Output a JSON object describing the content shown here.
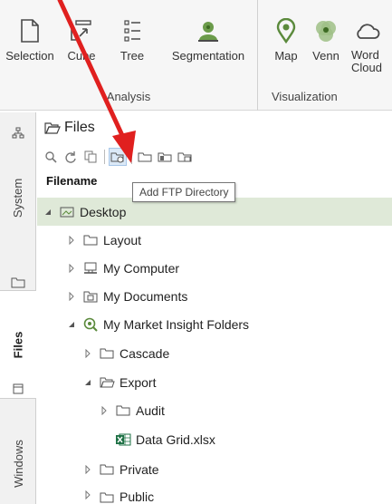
{
  "ribbon": {
    "analysis": {
      "label": "Analysis",
      "buttons": [
        {
          "label": "Selection",
          "icon": "selection-icon"
        },
        {
          "label": "Cube",
          "icon": "cube-icon"
        },
        {
          "label": "Tree",
          "icon": "tree-icon"
        },
        {
          "label": "Segmentation",
          "icon": "segmentation-icon"
        }
      ]
    },
    "visualization": {
      "label": "Visualization",
      "buttons": [
        {
          "label": "Map",
          "icon": "map-pin-icon"
        },
        {
          "label": "Venn",
          "icon": "venn-icon"
        },
        {
          "label": "Word\nCloud",
          "icon": "cloud-icon"
        }
      ]
    }
  },
  "sidebar": {
    "tabs": [
      {
        "label": "System",
        "active": false
      },
      {
        "label": "Files",
        "active": true
      },
      {
        "label": "Windows",
        "active": false
      }
    ]
  },
  "panel": {
    "title": "Files",
    "column_header": "Filename",
    "tooltip": "Add FTP Directory",
    "toolbar_icons": [
      "search-icon",
      "refresh-icon",
      "copy-icon",
      "add-ftp-directory-icon",
      "folder-icon",
      "folder-dark-icon",
      "folder-network-icon"
    ]
  },
  "tree": [
    {
      "label": "Desktop",
      "level": 0,
      "expanded": true,
      "icon": "desktop-icon",
      "selected": true
    },
    {
      "label": "Layout",
      "level": 1,
      "expanded": false,
      "icon": "folder-icon"
    },
    {
      "label": "My Computer",
      "level": 1,
      "expanded": false,
      "icon": "computer-icon"
    },
    {
      "label": "My Documents",
      "level": 1,
      "expanded": false,
      "icon": "documents-icon"
    },
    {
      "label": "My Market Insight Folders",
      "level": 1,
      "expanded": true,
      "icon": "market-insight-icon"
    },
    {
      "label": "Cascade",
      "level": 2,
      "expanded": false,
      "icon": "folder-icon"
    },
    {
      "label": "Export",
      "level": 2,
      "expanded": true,
      "icon": "folder-open-icon"
    },
    {
      "label": "Audit",
      "level": 3,
      "expanded": false,
      "icon": "folder-icon"
    },
    {
      "label": "Data Grid.xlsx",
      "level": 3,
      "expanded": null,
      "icon": "excel-icon"
    },
    {
      "label": "Private",
      "level": 2,
      "expanded": false,
      "icon": "folder-icon"
    },
    {
      "label": "Public",
      "level": 2,
      "expanded": false,
      "icon": "folder-icon"
    }
  ],
  "colors": {
    "accent_green": "#5b8a3c",
    "selection_row": "#dfe9d8",
    "annotation_arrow": "#e0201f"
  }
}
